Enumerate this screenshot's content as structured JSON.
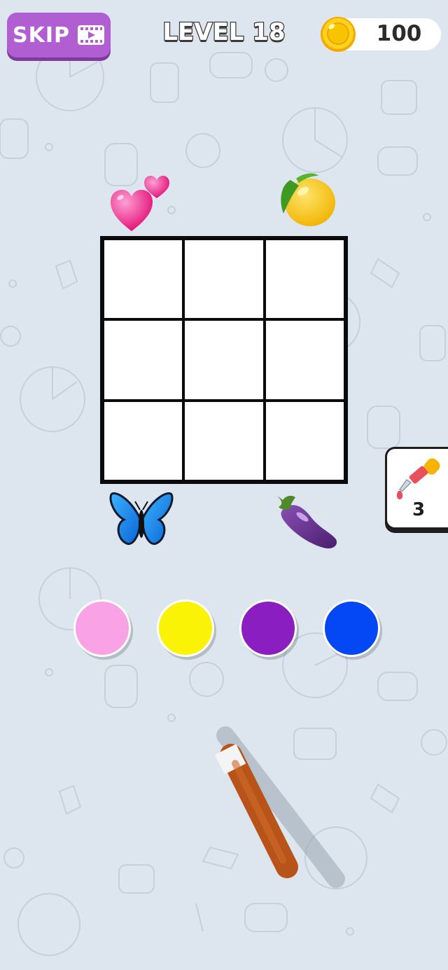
{
  "header": {
    "skip_label": "SKIP",
    "level_title": "LEVEL 18",
    "coins": "100"
  },
  "clues": {
    "top_left": "hearts",
    "top_right": "lemon",
    "bottom_left": "butterfly",
    "bottom_right": "eggplant"
  },
  "grid": {
    "rows": 3,
    "cols": 3
  },
  "hint": {
    "count": "3",
    "icon": "dropper-icon"
  },
  "palette": [
    {
      "name": "pink",
      "color": "#f9a3e6"
    },
    {
      "name": "yellow",
      "color": "#fbf305"
    },
    {
      "name": "purple",
      "color": "#8a1ec1"
    },
    {
      "name": "blue",
      "color": "#0447f5"
    }
  ],
  "colors": {
    "background": "#dde6ee",
    "skip_button": "#b05ed1",
    "grid_line": "#0b0b0b",
    "pencil": "#b8541a"
  }
}
